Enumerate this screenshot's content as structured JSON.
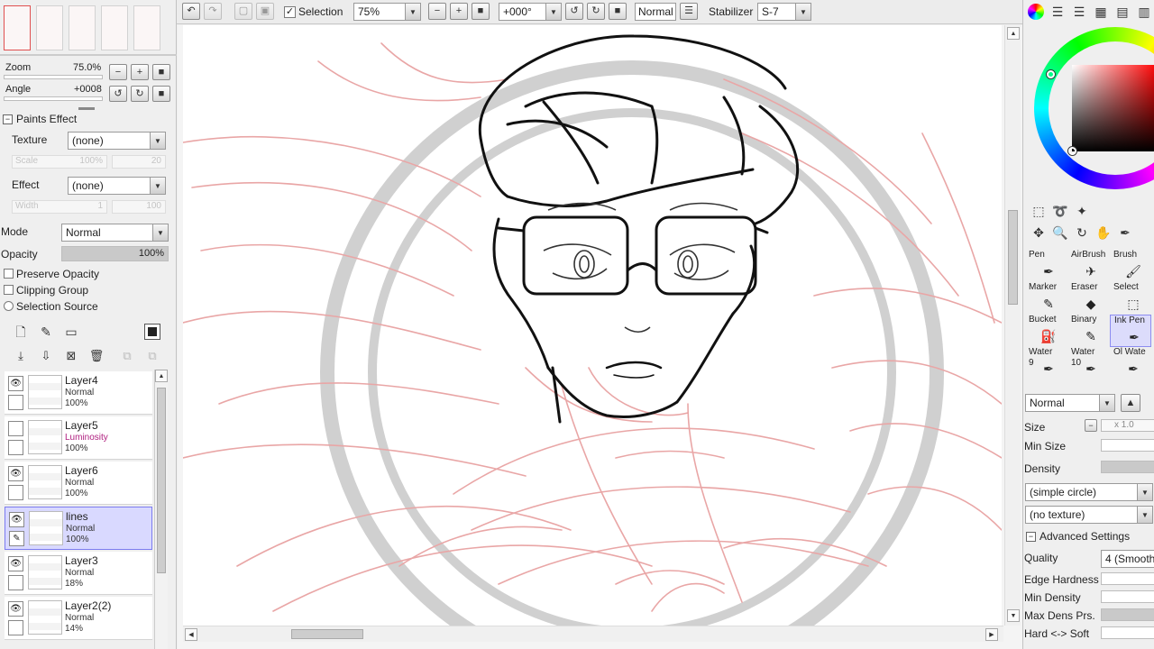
{
  "topbar": {
    "selection_label": "Selection",
    "zoom_value": "75%",
    "angle_value": "+000°",
    "blend_mode": "Normal",
    "stabilizer_label": "Stabilizer",
    "stabilizer_value": "S-7"
  },
  "navigator": {
    "zoom_label": "Zoom",
    "zoom_value": "75.0%",
    "angle_label": "Angle",
    "angle_value": "+0008"
  },
  "paints_effect": {
    "title": "Paints Effect",
    "texture_label": "Texture",
    "texture_value": "(none)",
    "scale_label": "Scale",
    "scale_value": "100%",
    "scale_num": "20",
    "effect_label": "Effect",
    "effect_value": "(none)",
    "width_label": "Width",
    "width_value": "1",
    "width_num": "100"
  },
  "layer_props": {
    "mode_label": "Mode",
    "mode_value": "Normal",
    "opacity_label": "Opacity",
    "opacity_value": "100%",
    "opacity_fraction": 1.0,
    "preserve_opacity": "Preserve Opacity",
    "clipping_group": "Clipping Group",
    "selection_source": "Selection Source"
  },
  "layers": [
    {
      "name": "Layer4",
      "mode": "Normal",
      "opacity": "100%",
      "visible": true,
      "selected": false
    },
    {
      "name": "Layer5",
      "mode": "Luminosity",
      "opacity": "100%",
      "visible": false,
      "selected": false
    },
    {
      "name": "Layer6",
      "mode": "Normal",
      "opacity": "100%",
      "visible": true,
      "selected": false
    },
    {
      "name": "lines",
      "mode": "Normal",
      "opacity": "100%",
      "visible": true,
      "selected": true
    },
    {
      "name": "Layer3",
      "mode": "Normal",
      "opacity": "18%",
      "visible": true,
      "selected": false
    },
    {
      "name": "Layer2(2)",
      "mode": "Normal",
      "opacity": "14%",
      "visible": true,
      "selected": false
    }
  ],
  "tools": [
    {
      "name": "Pen",
      "icon": "pen-icon"
    },
    {
      "name": "AirBrush",
      "icon": "airbrush-icon"
    },
    {
      "name": "Brush",
      "icon": "brush-icon"
    },
    {
      "name": "Marker",
      "icon": "marker-icon"
    },
    {
      "name": "Eraser",
      "icon": "eraser-icon"
    },
    {
      "name": "Select",
      "icon": "select-icon"
    },
    {
      "name": "Bucket",
      "icon": "bucket-icon"
    },
    {
      "name": "Binary",
      "icon": "binary-icon"
    },
    {
      "name": "Ink Pen",
      "icon": "ink-pen-icon"
    },
    {
      "name": "Water",
      "sub": "9",
      "icon": "water-icon"
    },
    {
      "name": "Water",
      "sub": "10",
      "icon": "water-icon"
    },
    {
      "name": "Ol Wate",
      "icon": "oil-water-icon"
    }
  ],
  "brush": {
    "blend": "Normal",
    "size_label": "Size",
    "size_mult": "x 1.0",
    "min_size_label": "Min Size",
    "density_label": "Density",
    "shape_value": "(simple circle)",
    "texture_value": "(no texture)",
    "advanced_label": "Advanced Settings",
    "quality_label": "Quality",
    "quality_value": "4 (Smooth",
    "edge_hardness_label": "Edge Hardness",
    "min_density_label": "Min Density",
    "max_dens_label": "Max Dens Prs.",
    "hard_soft_label": "Hard <-> Soft"
  },
  "colors": {
    "accent": "#8c8cf0",
    "sketch_red": "#e8a0a0",
    "lines": "#111111"
  }
}
